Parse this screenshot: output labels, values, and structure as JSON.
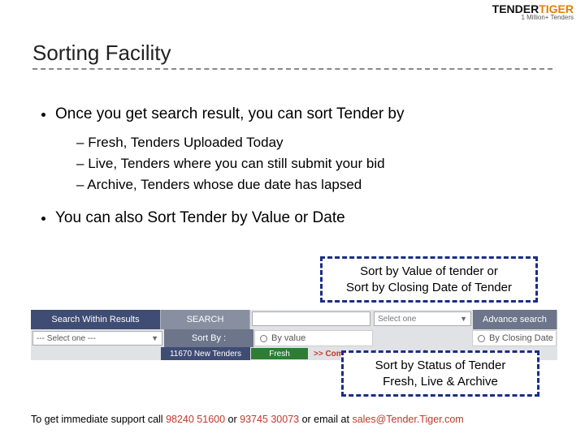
{
  "logo": {
    "part1": "TENDER",
    "part2": "TIGER",
    "tagline": "1 Million+ Tenders"
  },
  "title": "Sorting Facility",
  "bullets": {
    "b1": "Once you get search result, you can sort Tender by",
    "sub": [
      "Fresh, Tenders Uploaded Today",
      "Live, Tenders where you can still submit your bid",
      "Archive, Tenders whose due date has lapsed"
    ],
    "b2": "You can also Sort Tender by Value or Date"
  },
  "callouts": {
    "c1_line1": "Sort by Value of tender or",
    "c1_line2": "Sort by Closing Date of Tender",
    "c2_line1": "Sort by Status of Tender",
    "c2_line2": "Fresh, Live & Archive"
  },
  "searchbar": {
    "swr": "Search Within Results",
    "search_label": "SEARCH",
    "select_one": "Select one",
    "advance": "Advance search",
    "drop_placeholder": "--- Select one ---",
    "sort_by": "Sort By :",
    "by_value": "By value",
    "by_closing": "By Closing Date",
    "count": "11670 New Tenders",
    "fresh": "Fresh",
    "company": ">> Company Industry - Banking and M"
  },
  "footer": {
    "pre": "To get immediate support call ",
    "phone1": "98240 51600",
    "or1": " or ",
    "phone2": "93745 30073",
    "or2": " or email at ",
    "email": "sales@Tender.Tiger.com"
  }
}
